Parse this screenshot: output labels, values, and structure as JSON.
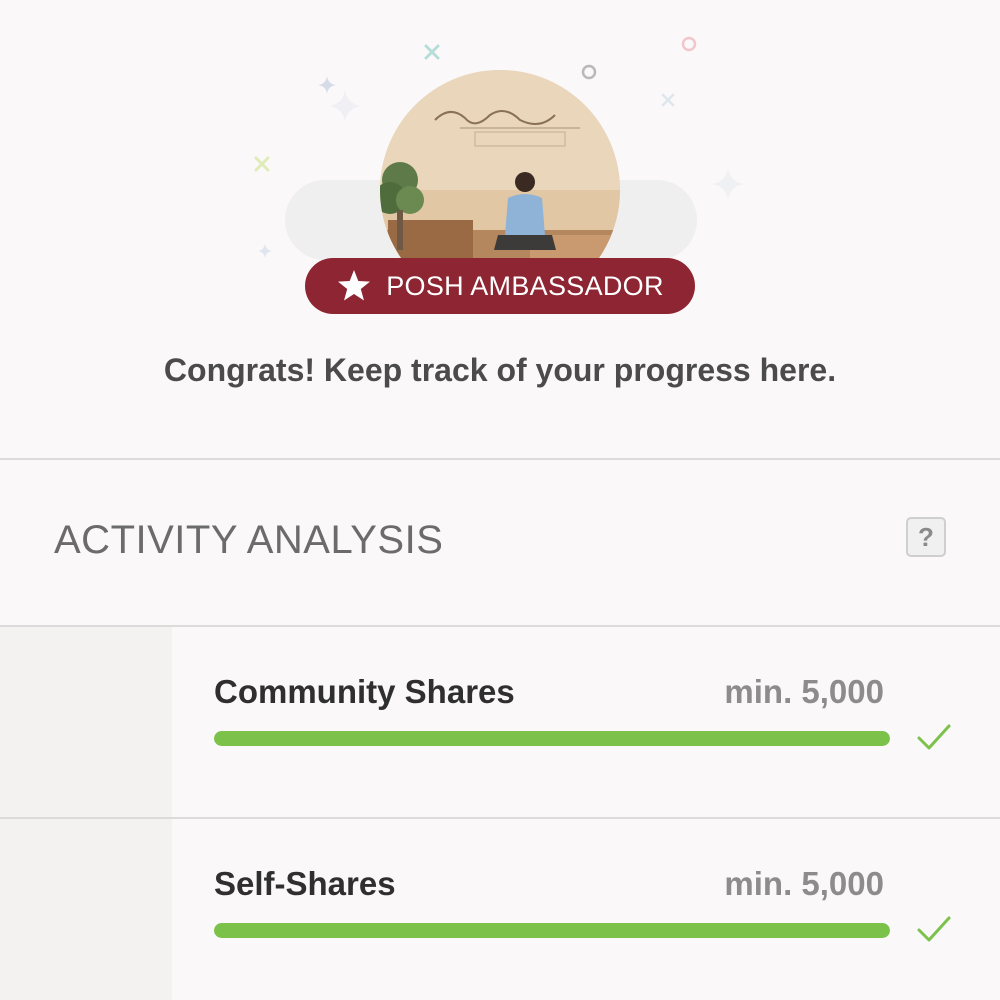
{
  "header": {
    "avatar_icon": "profile-photo",
    "badge": {
      "icon": "star-icon",
      "label": "POSH AMBASSADOR",
      "color": "#8e2532"
    },
    "congrats_text": "Congrats! Keep track of your progress here."
  },
  "activity": {
    "title": "ACTIVITY ANALYSIS",
    "help_label": "?",
    "metrics": [
      {
        "label": "Community Shares",
        "min": "min. 5,000",
        "progress": 1.0,
        "status_icon": "check-icon"
      },
      {
        "label": "Self-Shares",
        "min": "min. 5,000",
        "progress": 1.0,
        "status_icon": "check-icon"
      }
    ]
  },
  "colors": {
    "accent": "#8e2532",
    "progress": "#7cc24a",
    "check": "#7cc24a"
  }
}
